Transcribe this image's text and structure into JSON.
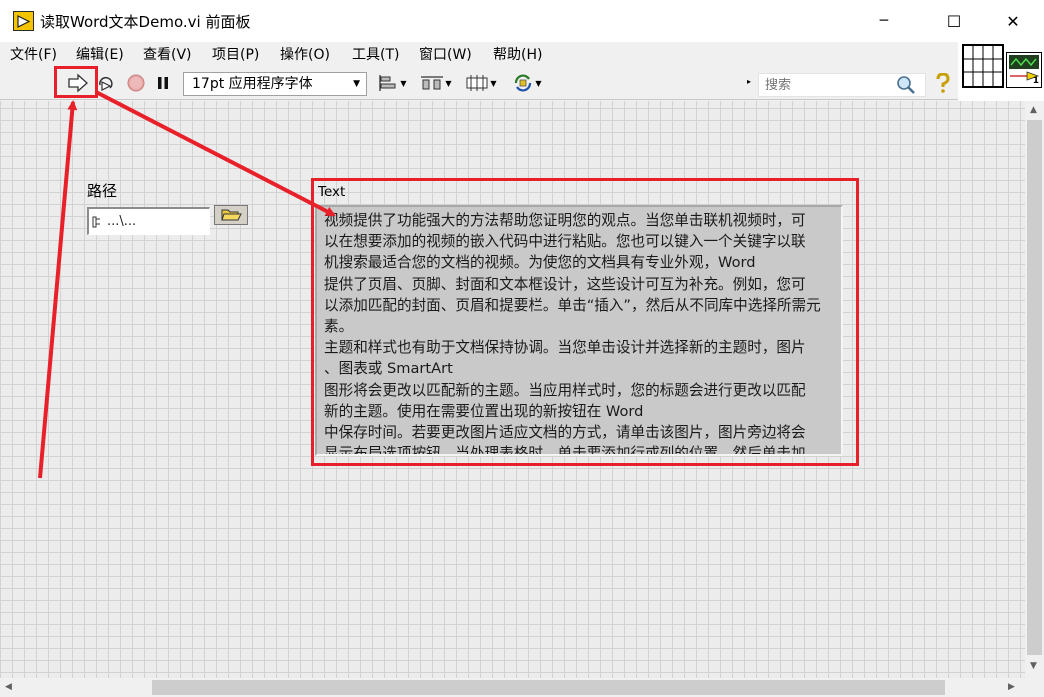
{
  "window": {
    "title": "读取Word文本Demo.vi 前面板",
    "minimize_glyph": "─",
    "maximize_glyph": "☐",
    "close_glyph": "✕"
  },
  "menu": [
    {
      "label": "文件(F)"
    },
    {
      "label": "编辑(E)"
    },
    {
      "label": "查看(V)"
    },
    {
      "label": "项目(P)"
    },
    {
      "label": "操作(O)"
    },
    {
      "label": "工具(T)"
    },
    {
      "label": "窗口(W)"
    },
    {
      "label": "帮助(H)"
    }
  ],
  "toolbar": {
    "font": "17pt 应用程序字体",
    "search_placeholder": "搜索",
    "tools": [
      "run-arrow-icon",
      "run-continuously-icon",
      "abort-icon",
      "pause-icon",
      "align-objects-icon",
      "distribute-objects-icon",
      "resize-objects-icon",
      "reorder-icon",
      "search-icon",
      "help-icon"
    ]
  },
  "connector_pane": {
    "terminal_number": "1"
  },
  "front_panel": {
    "path_control": {
      "label": "路径",
      "value": "...\\..."
    },
    "text_indicator": {
      "label": "Text",
      "lines": [
        "视频提供了功能强大的方法帮助您证明您的观点。当您单击联机视频时，可",
        "以在想要添加的视频的嵌入代码中进行粘贴。您也可以键入一个关键字以联",
        "机搜索最适合您的文档的视频。为使您的文档具有专业外观，Word",
        "提供了页眉、页脚、封面和文本框设计，这些设计可互为补充。例如，您可",
        "以添加匹配的封面、页眉和提要栏。单击“插入”，然后从不同库中选择所需元",
        "素。",
        "主题和样式也有助于文档保持协调。当您单击设计并选择新的主题时，图片",
        "、图表或 SmartArt",
        "图形将会更改以匹配新的主题。当应用样式时，您的标题会进行更改以匹配",
        "新的主题。使用在需要位置出现的新按钮在 Word",
        "中保存时间。若要更改图片适应文档的方式，请单击该图片，图片旁边将会",
        "显示布局选项按钮。当处理表格时，单击要添加行或列的位置，然后单击加"
      ]
    }
  },
  "annotation": {
    "color": "#e8202a"
  }
}
